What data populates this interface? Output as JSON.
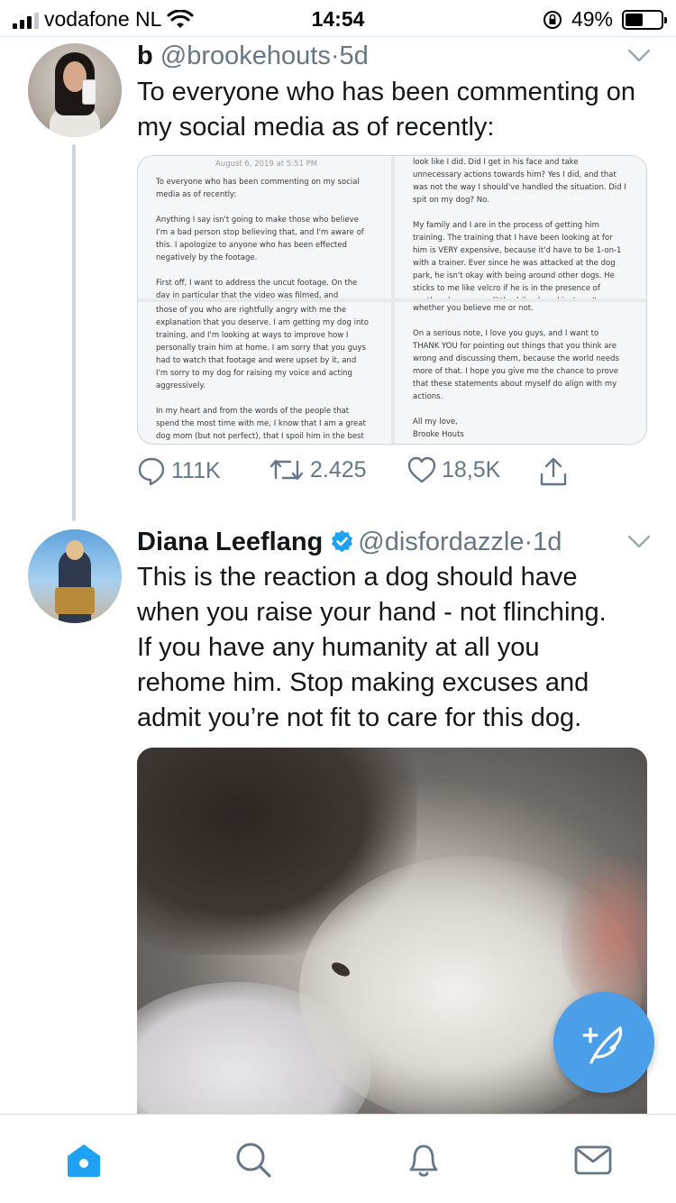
{
  "status_bar": {
    "carrier": "vodafone NL",
    "time": "14:54",
    "battery": "49%",
    "battery_level": 0.49,
    "icons": [
      "signal-icon",
      "wifi-icon",
      "rotation-lock-icon",
      "battery-icon"
    ]
  },
  "tweets": [
    {
      "name": "b",
      "handle": "@brookehouts",
      "separator": "·",
      "time": "5d",
      "text": "To everyone who has been commenting on my social media as of recently:",
      "image_cells": [
        {
          "date": "August 6, 2019 at 5:51 PM",
          "paragraphs": [
            "To everyone who has been commenting on my social\nmedia as of recently:",
            "Anything I say isn't going to make those who believe\nI'm a bad person stop believing that, and I'm aware of\nthis. I apologize to anyone who has been effected\nnegatively by the footage.",
            "First off, I want to address the uncut footage. On the\nday in particular that the video was filmed, and"
          ]
        },
        {
          "paragraphs": [
            "look like I did. Did I get in his face and take\nunnecessary actions towards him? Yes I did, and that\nwas not the way I should've handled the situation. Did I\nspit on my dog? No.",
            "My family and I are in the process of getting him\ntraining. The training that I have been looking at for\nhim is VERY expensive, because it'd have to be 1-on-1\nwith a trainer. Ever since he was attacked at the dog\npark, he isn't okay with being around other dogs. He\nsticks to me like velcro if he is in the presence of\nanother dog, even a little chihuahua. I just can't see"
          ]
        },
        {
          "paragraphs": [
            "those of you who are rightfully angry with me the\nexplanation that you deserve. I am getting my dog into\ntraining, and I'm looking at ways to improve how I\npersonally train him at home. I am sorry that you guys\nhad to watch that footage and were upset by it, and\nI'm sorry to my dog for raising my voice and acting\naggressively.",
            "In my heart and from the words of the people that\nspend the most time with me, I know that I am a great\ndog mom (but not perfect), that I spoil him in the best"
          ]
        },
        {
          "paragraphs": [
            "whether you believe me or not.",
            "On a serious note, I love you guys, and I want to\nTHANK YOU for pointing out things that you think are\nwrong and discussing them, because the world needs\nmore of that. I hope you give me the chance to prove\nthat these statements about myself do align with my\nactions.",
            "All my love,\nBrooke Houts"
          ]
        }
      ],
      "actions": {
        "replies": "111K",
        "retweets": "2.425",
        "likes": "18,5K"
      }
    },
    {
      "name": "Diana Leeflang",
      "handle": "@disfordazzle",
      "separator": "·",
      "time": "1d",
      "verified": true,
      "text_lines": [
        "This is the reaction a dog should have",
        "when you raise your hand - not flinching.",
        "If you have any humanity at all you",
        "rehome him. Stop making excuses and",
        "admit you’re not fit to care for this dog."
      ]
    }
  ],
  "tab_bar": {
    "items": [
      "home-icon",
      "search-icon",
      "notifications-icon",
      "messages-icon"
    ],
    "active": "home-icon"
  },
  "colors": {
    "accent": "#1da1f2",
    "fab": "#4a9fe8",
    "secondary_text": "#657786",
    "divider": "#e1e8ed"
  }
}
